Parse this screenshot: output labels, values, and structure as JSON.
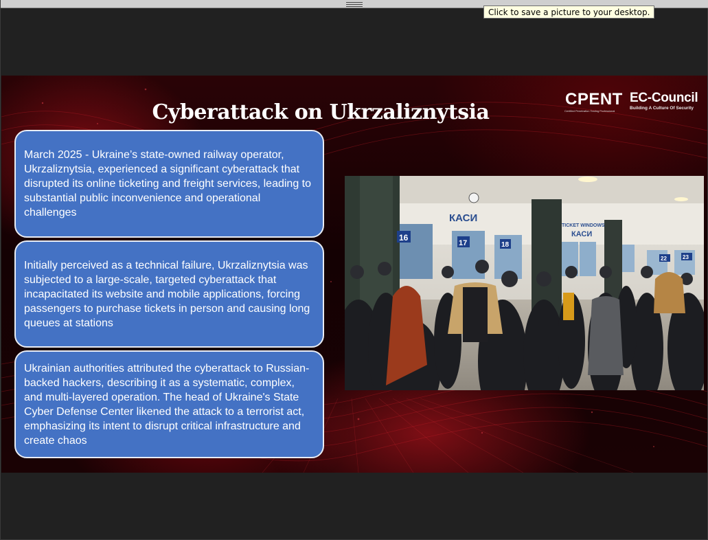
{
  "window": {
    "tooltip": "Click to save a picture to your desktop."
  },
  "slide": {
    "title": "Cyberattack on Ukrzaliznytsia",
    "logos": {
      "cpent": "CPENT",
      "cpent_sub": "Certified Penetration Testing Professional",
      "ec_council": "EC-Council",
      "ec_tagline": "Building A Culture Of Security"
    },
    "cards": [
      {
        "text": "March 2025 - Ukraine’s state-owned railway operator, Ukrzaliznytsia, experienced a significant cyberattack that disrupted its online ticketing and freight services, leading to substantial public inconvenience and operational challenges"
      },
      {
        "text": "Initially perceived as a technical failure, Ukrzaliznytsia was subjected to a large-scale, targeted cyberattack that incapacitated its website and mobile applications, forcing passengers to purchase tickets in person and causing long queues at stations"
      },
      {
        "text": "Ukrainian authorities attributed the cyberattack to Russian-backed hackers, describing it as a systematic, complex, and multi-layered operation. The head of Ukraine's State Cyber Defense Center likened the attack to a terrorist act, emphasizing its intent to disrupt critical infrastructure and create chaos"
      }
    ],
    "photo": {
      "sign_kasy": "КАСИ",
      "sign_kasy_2": "КАСИ",
      "sign_ticket": "TICKET WINDOWS",
      "window_16": "16",
      "window_17": "17",
      "window_18": "18",
      "window_22": "22",
      "window_23": "23"
    }
  },
  "colors": {
    "card_fill": "#4472c4",
    "card_border": "#e9edf5",
    "slide_bg": "#1a0204",
    "accent_red": "#c8141e"
  }
}
